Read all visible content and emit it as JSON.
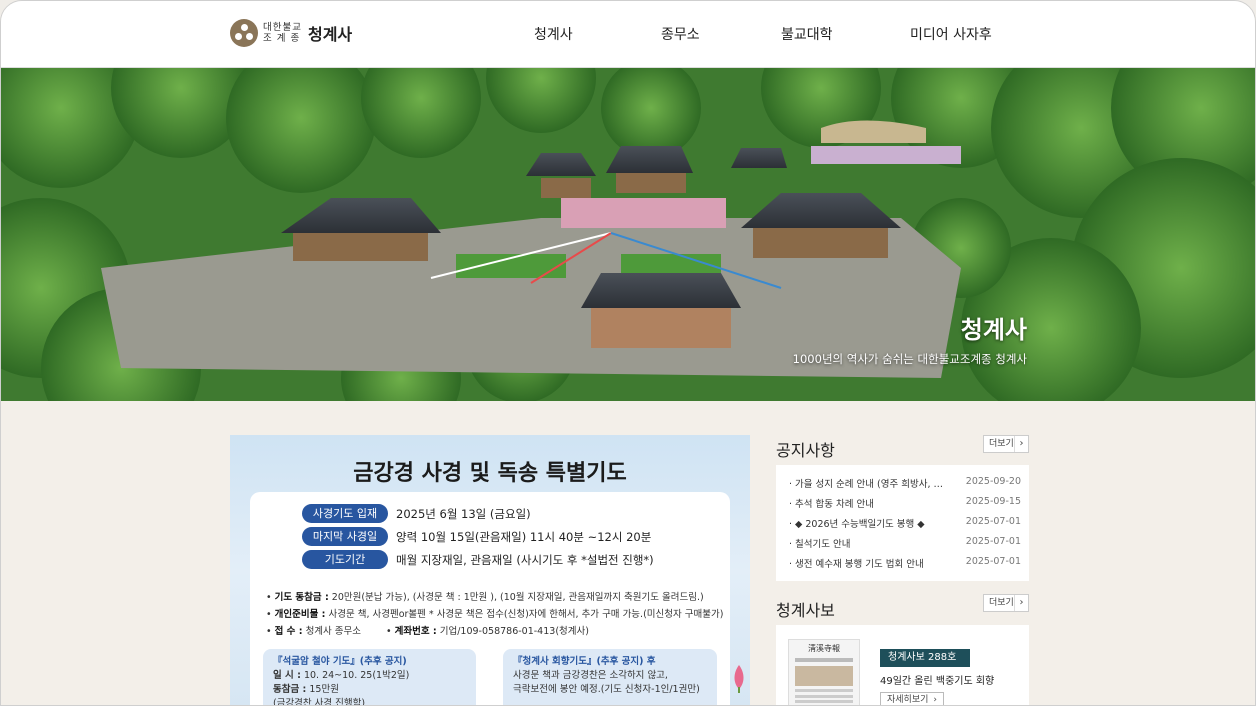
{
  "header": {
    "logo_small_line1": "대한불교",
    "logo_small_line2": "조 계 종",
    "logo_name": "청계사",
    "nav": [
      "청계사",
      "종무소",
      "불교대학",
      "미디어 사자후"
    ]
  },
  "hero": {
    "title": "청계사",
    "subtitle": "1000년의 역사가 숨쉬는 대한불교조계종 청계사"
  },
  "banner": {
    "title": "금강경 사경 및 독송 특별기도",
    "rows": [
      {
        "label": "사경기도 입재",
        "value": "2025년 6월 13일 (금요일)"
      },
      {
        "label": "마지막 사경일",
        "value": "양력 10월 15일(관음재일) 11시 40분 ~12시 20분"
      },
      {
        "label": "기도기간",
        "value": "매월 지장재일, 관음재일 (사시기도 후 *설법전 진행*)"
      }
    ],
    "info1_label": "기도 동참금 :",
    "info1_value": "20만원(분납 가능), (사경문 책 : 1만원 ), (10월 지장재일, 관음재일까지 축원기도 올려드림.)",
    "info2_label": "개인준비물 :",
    "info2_value": "사경문 책, 사경펜or볼펜 * 사경문 책은 접수(신청)자에 한해서, 추가 구매 가능.(미신청자 구매불가)",
    "info3_label": "접 수 :",
    "info3_value": "청계사 종무소",
    "info4_label": "계좌번호 :",
    "info4_value": "기업/109-058786-01-413(청계사)",
    "box1_title": "『석굴암 철야 기도』(추후 공지)",
    "box1_line1_label": "일 시 :",
    "box1_line1_value": "10. 24~10. 25(1박2일)",
    "box1_line2_label": "동참금 :",
    "box1_line2_value": "15만원",
    "box1_line3": "(금강경찬 사경 진행함)",
    "box2_title": "『청계사 회향기도』(추후 공지) 후",
    "box2_line1": "사경문 책과 금강경찬은 소각하지 않고,",
    "box2_line2": "극락보전에 봉안 예정.(기도 신청자-1인/1권만)"
  },
  "notice": {
    "title": "공지사항",
    "more": "더보기",
    "items": [
      {
        "title": "가을 성지 순례 안내 (영주 희방사, …",
        "date": "2025-09-20"
      },
      {
        "title": "추석 합동 차례 안내",
        "date": "2025-09-15"
      },
      {
        "title": "◆ 2026년 수능백일기도 봉행 ◆",
        "date": "2025-07-01"
      },
      {
        "title": "칠석기도 안내",
        "date": "2025-07-01"
      },
      {
        "title": "생전 예수재 봉행 기도 법회 안내",
        "date": "2025-07-01"
      }
    ]
  },
  "newsletter": {
    "title": "청계사보",
    "more": "더보기",
    "tag": "청계사보 288호",
    "headline": "49일간 올린 백중기도 회향",
    "button": "자세히보기",
    "paper_masthead": "淸溪寺報"
  },
  "colors": {
    "pill_blue": "#2856a0",
    "news_tag": "#1e4f5a",
    "logo_brown": "#8a7558"
  }
}
